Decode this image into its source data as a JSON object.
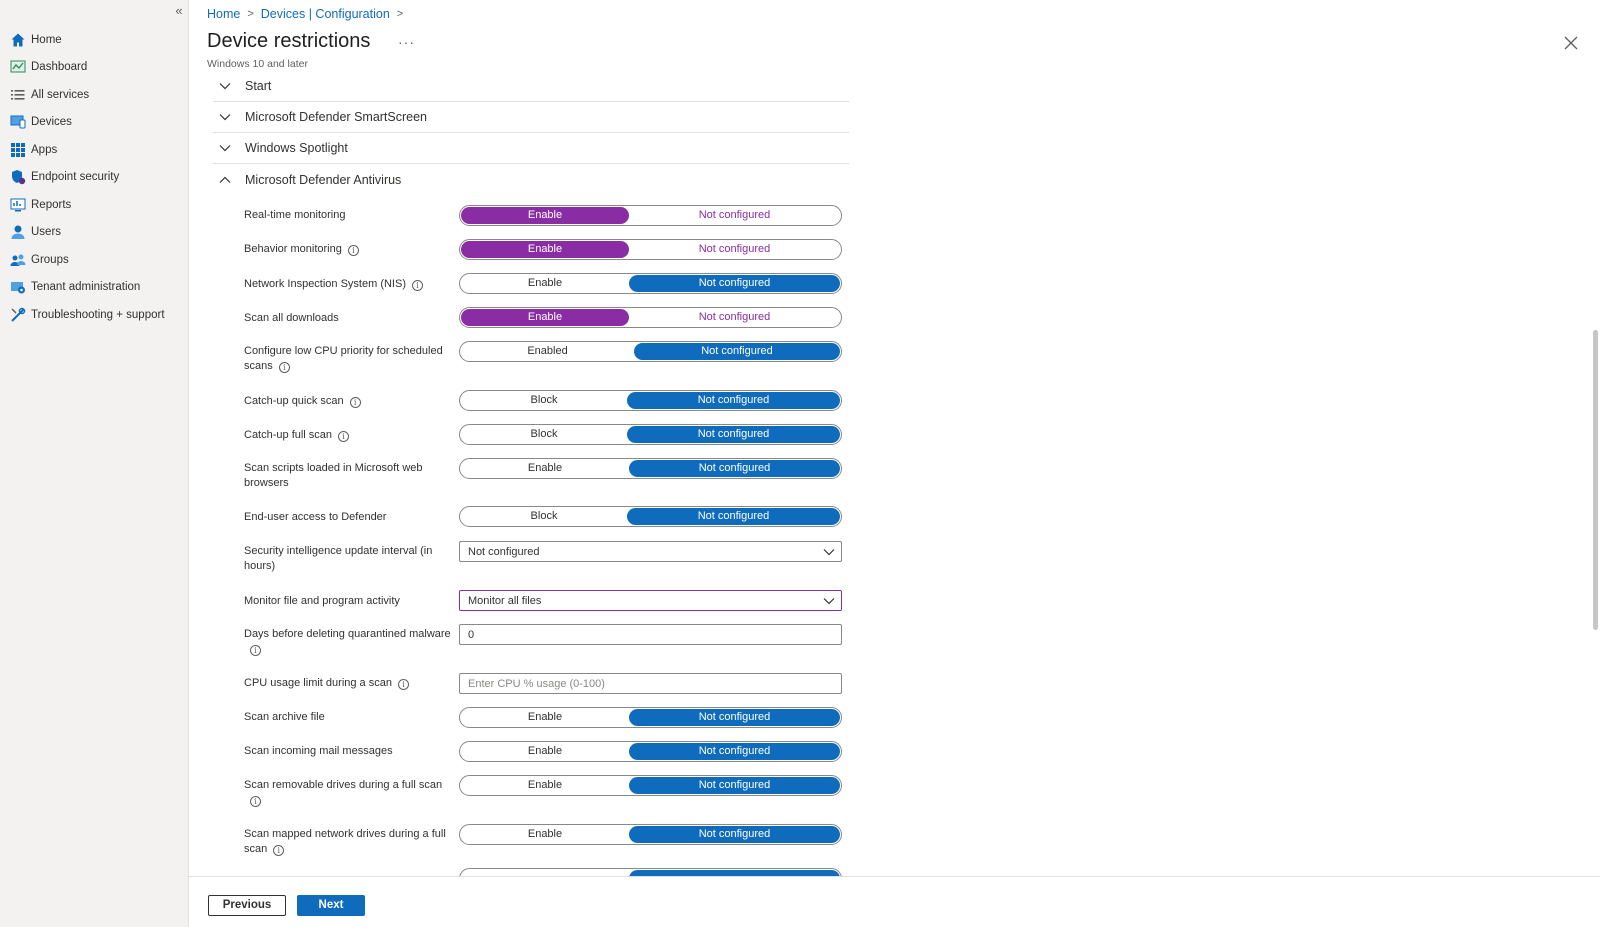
{
  "sidebar": {
    "collapse_glyph": "«",
    "items": [
      {
        "label": "Home",
        "icon": "home-icon"
      },
      {
        "label": "Dashboard",
        "icon": "dashboard-icon"
      },
      {
        "label": "All services",
        "icon": "list-icon"
      },
      {
        "label": "Devices",
        "icon": "devices-icon"
      },
      {
        "label": "Apps",
        "icon": "apps-icon"
      },
      {
        "label": "Endpoint security",
        "icon": "shield-icon"
      },
      {
        "label": "Reports",
        "icon": "reports-icon"
      },
      {
        "label": "Users",
        "icon": "user-icon"
      },
      {
        "label": "Groups",
        "icon": "groups-icon"
      },
      {
        "label": "Tenant administration",
        "icon": "gear-icon"
      },
      {
        "label": "Troubleshooting + support",
        "icon": "wrench-icon"
      }
    ]
  },
  "header": {
    "breadcrumb": [
      "Home",
      "Devices | Configuration"
    ],
    "title": "Device restrictions",
    "more": "···",
    "subtitle": "Windows 10 and later"
  },
  "sections": [
    {
      "label": "Start",
      "expanded": false
    },
    {
      "label": "Microsoft Defender SmartScreen",
      "expanded": false
    },
    {
      "label": "Windows Spotlight",
      "expanded": false
    },
    {
      "label": "Microsoft Defender Antivirus",
      "expanded": true
    }
  ],
  "settings": {
    "realtime": {
      "label": "Real-time monitoring",
      "left": "Enable",
      "right": "Not configured",
      "selected": "left"
    },
    "behavior": {
      "label": "Behavior monitoring",
      "left": "Enable",
      "right": "Not configured",
      "selected": "left"
    },
    "nis": {
      "label": "Network Inspection System (NIS)",
      "left": "Enable",
      "right": "Not configured",
      "selected": "right"
    },
    "downloads": {
      "label": "Scan all downloads",
      "left": "Enable",
      "right": "Not configured",
      "selected": "left"
    },
    "lowcpu": {
      "label": "Configure low CPU priority for scheduled scans",
      "left": "Enabled",
      "right": "Not configured",
      "selected": "right"
    },
    "quickscan": {
      "label": "Catch-up quick scan",
      "left": "Block",
      "right": "Not configured",
      "selected": "right"
    },
    "fullscan": {
      "label": "Catch-up full scan",
      "left": "Block",
      "right": "Not configured",
      "selected": "right"
    },
    "scripts": {
      "label": "Scan scripts loaded in Microsoft web browsers",
      "left": "Enable",
      "right": "Not configured",
      "selected": "right"
    },
    "enduser": {
      "label": "End-user access to Defender",
      "left": "Block",
      "right": "Not configured",
      "selected": "right"
    },
    "interval": {
      "label": "Security intelligence update interval (in hours)",
      "value": "Not configured"
    },
    "monitor": {
      "label": "Monitor file and program activity",
      "value": "Monitor all files"
    },
    "quarantine": {
      "label": "Days before deleting quarantined malware",
      "value": "0"
    },
    "cpulimit": {
      "label": "CPU usage limit during a scan",
      "placeholder": "Enter CPU % usage (0-100)"
    },
    "archive": {
      "label": "Scan archive file",
      "left": "Enable",
      "right": "Not configured",
      "selected": "right"
    },
    "mail": {
      "label": "Scan incoming mail messages",
      "left": "Enable",
      "right": "Not configured",
      "selected": "right"
    },
    "removable": {
      "label": "Scan removable drives during a full scan",
      "left": "Enable",
      "right": "Not configured",
      "selected": "right"
    },
    "mapped": {
      "label": "Scan mapped network drives during a full scan",
      "left": "Enable",
      "right": "Not configured",
      "selected": "right"
    }
  },
  "footer": {
    "previous": "Previous",
    "next": "Next"
  },
  "colors": {
    "accent_blue": "#0f6cbd",
    "accent_purple": "#8a2da5"
  }
}
